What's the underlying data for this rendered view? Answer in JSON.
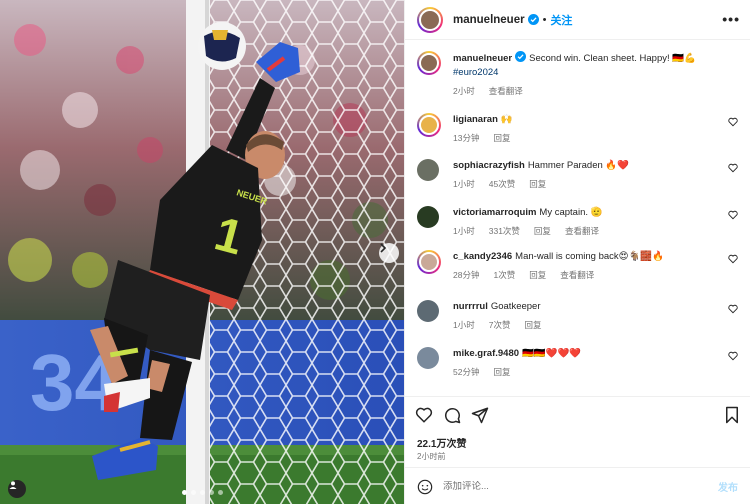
{
  "header": {
    "username": "manuelneuer",
    "separator": "•",
    "follow_label": "关注",
    "more_label": "•••"
  },
  "caption": {
    "username": "manuelneuer",
    "text": "Second win. Clean sheet. Happy! 🇩🇪💪",
    "hashtag": "#euro2024",
    "time": "2小时",
    "translate": "查看翻译"
  },
  "comments": [
    {
      "username": "ligianaran",
      "text": "🙌",
      "time": "13分钟",
      "likes": "",
      "reply": "回复",
      "translate": "",
      "avatar_color": "#e8b24a",
      "story_ring": true
    },
    {
      "username": "sophiacrazyfish",
      "text": "Hammer Paraden 🔥❤️",
      "time": "1小时",
      "likes": "45次赞",
      "reply": "回复",
      "translate": "",
      "avatar_color": "#6a6f63",
      "story_ring": false
    },
    {
      "username": "victoriamarroquim",
      "text": "My captain. 🫡",
      "time": "1小时",
      "likes": "331次赞",
      "reply": "回复",
      "translate": "查看翻译",
      "avatar_color": "#283b22",
      "story_ring": false
    },
    {
      "username": "c_kandy2346",
      "text": "Man-wall is coming back😍🐐🧱🔥",
      "time": "28分钟",
      "likes": "1次赞",
      "reply": "回复",
      "translate": "查看翻译",
      "avatar_color": "#c9a998",
      "story_ring": true
    },
    {
      "username": "nurrrrul",
      "text": "Goatkeeper",
      "time": "1小时",
      "likes": "7次赞",
      "reply": "回复",
      "translate": "",
      "avatar_color": "#5d6a73",
      "story_ring": false
    },
    {
      "username": "mike.graf.9480",
      "text": "🇩🇪🇩🇪❤️❤️❤️",
      "time": "52分钟",
      "likes": "",
      "reply": "回复",
      "translate": "",
      "avatar_color": "#7a8a9c",
      "story_ring": false
    }
  ],
  "actions": {
    "likes": "22.1万次赞",
    "time": "2小时前",
    "comment_placeholder": "添加评论...",
    "post_label": "发布"
  },
  "colors": {
    "accent": "#0095f6",
    "verified": "#0095f6",
    "meta_text": "#737373",
    "jersey": "#1a1a1a",
    "jersey_number": "#c8e04a",
    "glove": "#2f5fd6"
  },
  "photo": {
    "jersey_number": "1",
    "jersey_name": "NEUER",
    "carousel_count": 5,
    "carousel_active": 1
  }
}
